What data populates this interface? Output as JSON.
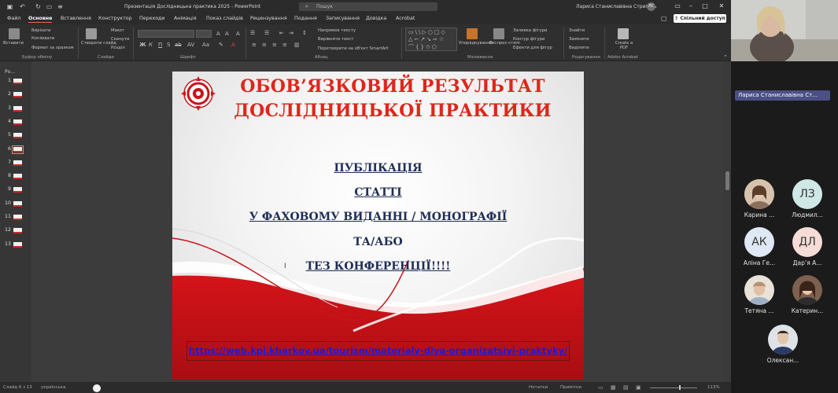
{
  "window": {
    "doc_title": "Презентація Дослідницька практика 2025 - PowerPoint",
    "search_placeholder": "Пошук",
    "user_name": "Лариса Станиславівна Стригуль",
    "user_initials": "ЛС",
    "share_label": "Спільний доступ"
  },
  "tabs": [
    "Файл",
    "Основне",
    "Вставлення",
    "Конструктор",
    "Переходи",
    "Анімація",
    "Показ слайдів",
    "Рецензування",
    "Подання",
    "Записування",
    "Довідка",
    "Acrobat"
  ],
  "active_tab": "Основне",
  "ribbon": {
    "clipboard": {
      "paste": "Вставити",
      "cut": "Вирізати",
      "copy": "Копіювати",
      "format": "Формат за зразком",
      "label": "Буфер обміну"
    },
    "slides": {
      "new_slide": "Створити слайд",
      "layout": "Макет",
      "reset": "Скинути",
      "section": "Розділ",
      "label": "Слайди"
    },
    "font": {
      "label": "Шрифт"
    },
    "paragraph": {
      "text_direction": "Напрямок тексту",
      "align_text": "Вирівняти текст",
      "smartart": "Перетворити на об'єкт SmartArt",
      "label": "Абзац"
    },
    "drawing": {
      "arrange": "Упорядкування",
      "quick_styles": "Експрес-стилі",
      "fill": "Заливка фігури",
      "outline": "Контур фігури",
      "effects": "Ефекти для фігур",
      "label": "Малювання"
    },
    "editing": {
      "find": "Знайти",
      "replace": "Замінити",
      "select": "Виділити",
      "label": "Редагування"
    },
    "acrobat": {
      "create_pdf": "Create a PDF",
      "label": "Adobe Acrobat"
    }
  },
  "thumbnails": {
    "header": "Ро...",
    "numbers": [
      "1",
      "2",
      "3",
      "4",
      "5",
      "6",
      "7",
      "8",
      "9",
      "10",
      "11",
      "12",
      "13"
    ],
    "selected": "6"
  },
  "slide": {
    "title": "ОБОВ’ЯЗКОВИЙ РЕЗУЛЬТАТ ДОСЛІДНИЦЬКОЇ ПРАКТИКИ",
    "lines": [
      "ПУБЛІКАЦІЯ",
      "СТАТТІ",
      "У ФАХОВОМУ ВИДАННІ / МОНОГРАФІЇ",
      "ТА/АБО",
      "ТЕЗ КОНФЕРЕНЦІЇ!!!!"
    ],
    "link": "https://web.kpi.kharkov.ua/tourism/materialy-diya-organizatsiyi-praktyky/",
    "colors": {
      "title": "#e0251b",
      "body": "#1f2d55",
      "link": "#1a1adf",
      "wave": "#c8141a"
    }
  },
  "statusbar": {
    "slide_info": "Слайд 6 з 13",
    "language": "українська",
    "notes": "Нотатки",
    "comments": "Примітки",
    "zoom": "113%"
  },
  "teams": {
    "presenter": "Лариса Станиславівна Ст...",
    "participants": [
      {
        "name": "Карина ...",
        "initials": "",
        "photo": true,
        "bg": "#c9a58c"
      },
      {
        "name": "Людмил...",
        "initials": "ЛЗ",
        "photo": false,
        "bg": "#cfe8e6"
      },
      {
        "name": "Аліна Ге...",
        "initials": "АК",
        "photo": false,
        "bg": "#dfe8f4"
      },
      {
        "name": "Дар’я А...",
        "initials": "ДЛ",
        "photo": false,
        "bg": "#f5dcd6"
      },
      {
        "name": "Тетяна ...",
        "initials": "",
        "photo": true,
        "bg": "#d6c8b8"
      },
      {
        "name": "Катерин...",
        "initials": "",
        "photo": true,
        "bg": "#8a6b58"
      },
      {
        "name": "Олексан...",
        "initials": "",
        "photo": true,
        "bg": "#cfd6df"
      }
    ]
  }
}
